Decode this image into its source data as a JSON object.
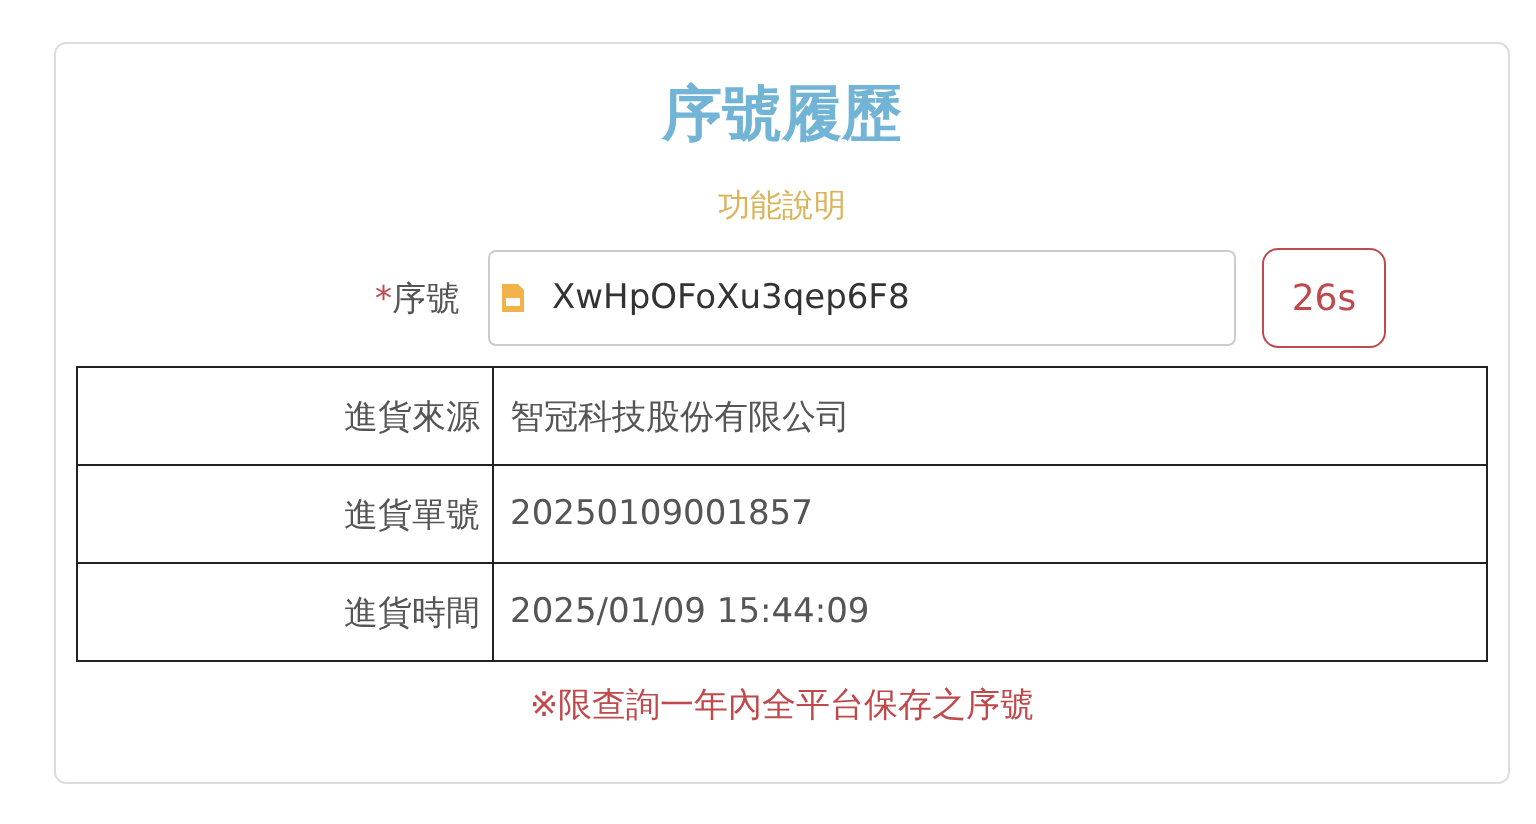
{
  "title": "序號履歷",
  "help_link": "功能說明",
  "serial_field": {
    "required_mark": "*",
    "label": "序號",
    "value": "XwHpOFoXu3qep6F8"
  },
  "countdown_button": "26s",
  "details": [
    {
      "label": "進貨來源",
      "value": "智冠科技股份有限公司"
    },
    {
      "label": "進貨單號",
      "value": "20250109001857"
    },
    {
      "label": "進貨時間",
      "value": "2025/01/09 15:44:09"
    }
  ],
  "note": "※限查詢一年內全平台保存之序號"
}
